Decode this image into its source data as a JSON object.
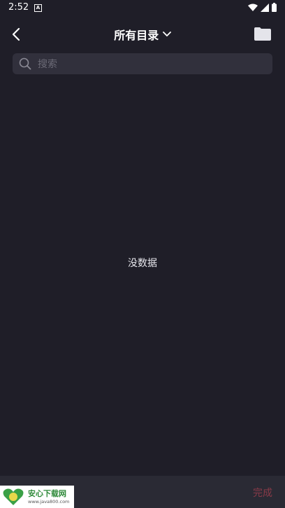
{
  "status_bar": {
    "time": "2:52",
    "a_glyph": "A"
  },
  "header": {
    "title": "所有目录",
    "back_icon": "chevron-left-icon",
    "folder_icon": "folder-icon"
  },
  "search": {
    "placeholder": "搜索",
    "value": ""
  },
  "main": {
    "empty_text": "没数据"
  },
  "bottom": {
    "done_label": "完成",
    "done_color": "#8a3a48"
  },
  "watermark": {
    "title": "安心下载网",
    "url": "www.java800.com"
  },
  "colors": {
    "background": "#1f1e28",
    "search_bg": "#31303c",
    "bottom_bg": "#2a2a34"
  }
}
